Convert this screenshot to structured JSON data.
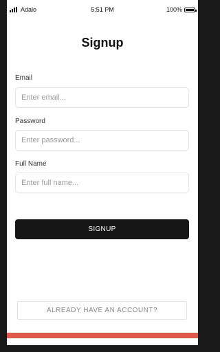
{
  "status_bar": {
    "carrier": "Adalo",
    "time": "5:51 PM",
    "battery": "100%",
    "battery_level": 1.0
  },
  "page": {
    "title": "Signup"
  },
  "form": {
    "email": {
      "label": "Email",
      "placeholder": "Enter email...",
      "value": ""
    },
    "password": {
      "label": "Password",
      "placeholder": "Enter password...",
      "value": ""
    },
    "full_name": {
      "label": "Full Name",
      "placeholder": "Enter full name...",
      "value": ""
    }
  },
  "buttons": {
    "signup": "SIGNUP",
    "have_account": "ALREADY HAVE AN ACCOUNT?"
  },
  "colors": {
    "primary_button": "#161616",
    "accent_bar": "#e4574b",
    "background": "#ffffff"
  },
  "icons": {
    "signal": "signal-bars-icon",
    "battery": "battery-icon"
  }
}
